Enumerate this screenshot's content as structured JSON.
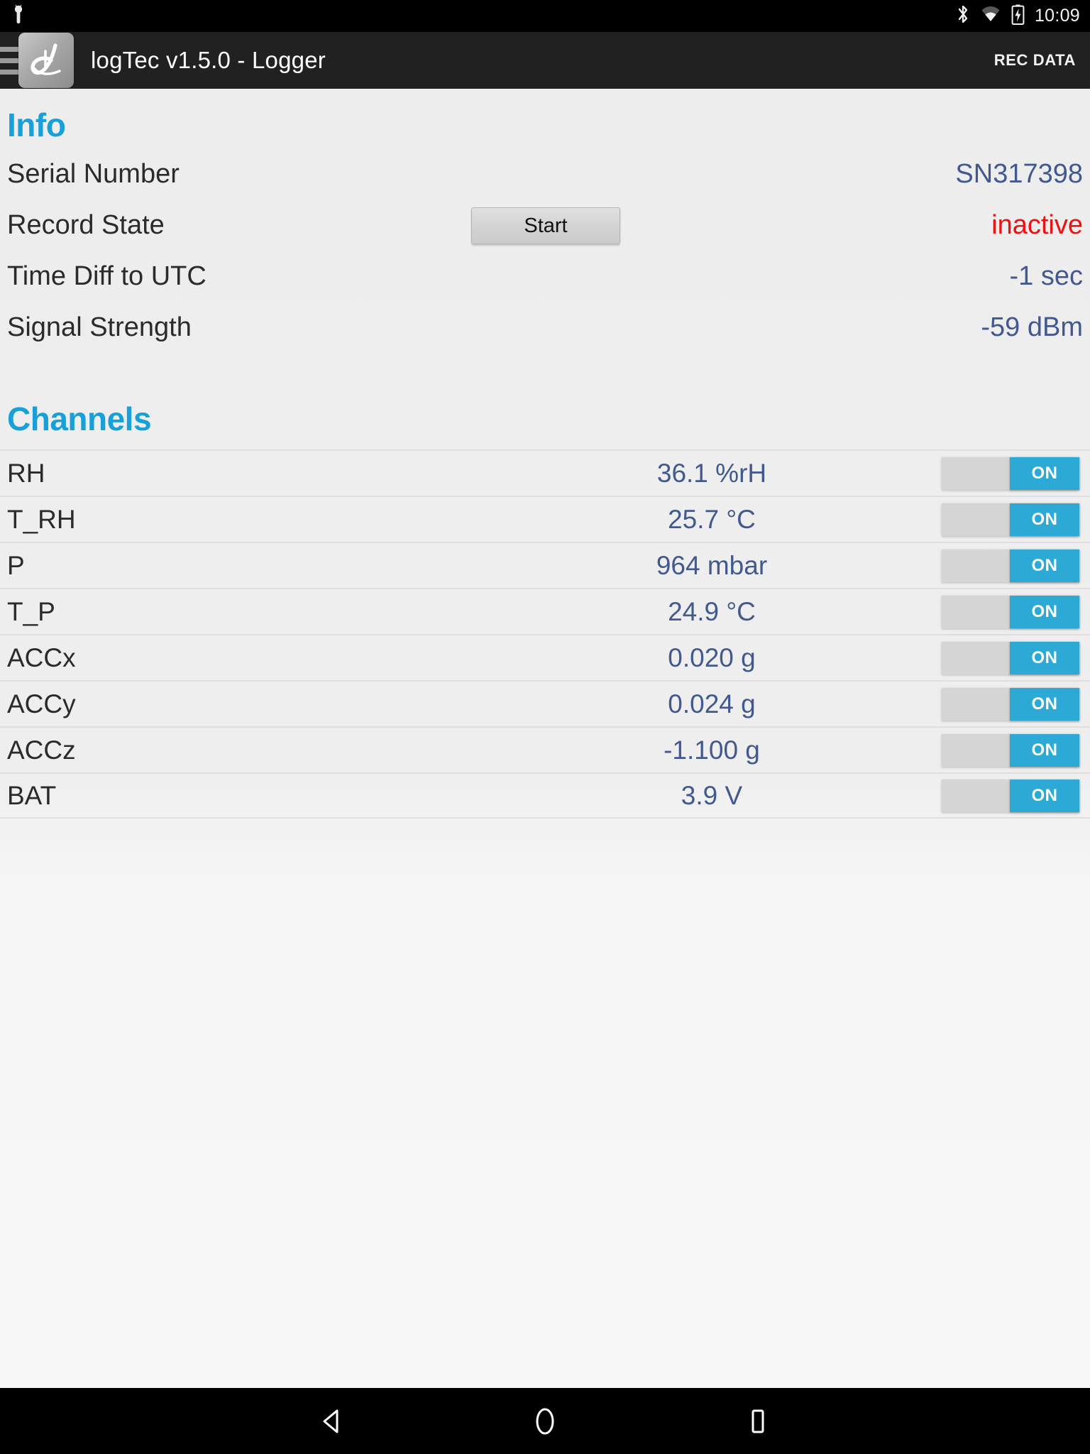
{
  "status_bar": {
    "notification_icon": "android-robot-icon",
    "bluetooth_icon": "bluetooth-icon",
    "wifi_icon": "wifi-icon",
    "battery_icon": "battery-charging-icon",
    "clock": "10:09"
  },
  "app_bar": {
    "menu_icon": "hamburger-menu-icon",
    "logo_icon": "logtec-logo-icon",
    "title": "logTec v1.5.0 - Logger",
    "action_label": "REC DATA"
  },
  "info": {
    "heading": "Info",
    "start_button": "Start",
    "rows": [
      {
        "label": "Serial Number",
        "value": "SN317398"
      },
      {
        "label": "Record State",
        "value": "inactive"
      },
      {
        "label": "Time Diff to UTC",
        "value": "-1 sec"
      },
      {
        "label": "Signal Strength",
        "value": "-59 dBm"
      }
    ]
  },
  "channels": {
    "heading": "Channels",
    "rows": [
      {
        "name": "RH",
        "value": "36.1 %rH",
        "toggle": "ON"
      },
      {
        "name": "T_RH",
        "value": "25.7 °C",
        "toggle": "ON"
      },
      {
        "name": "P",
        "value": "964 mbar",
        "toggle": "ON"
      },
      {
        "name": "T_P",
        "value": "24.9 °C",
        "toggle": "ON"
      },
      {
        "name": "ACCx",
        "value": "0.020 g",
        "toggle": "ON"
      },
      {
        "name": "ACCy",
        "value": "0.024 g",
        "toggle": "ON"
      },
      {
        "name": "ACCz",
        "value": "-1.100 g",
        "toggle": "ON"
      },
      {
        "name": "BAT",
        "value": "3.9 V",
        "toggle": "ON"
      }
    ]
  },
  "nav_bar": {
    "back_icon": "back-triangle-icon",
    "home_icon": "home-circle-icon",
    "recents_icon": "recents-square-icon"
  },
  "colors": {
    "accent": "#18a0d8",
    "value_text": "#41598e",
    "alert": "#ee1111",
    "toggle_on": "#2da9d6",
    "appbar_bg": "#212121"
  }
}
